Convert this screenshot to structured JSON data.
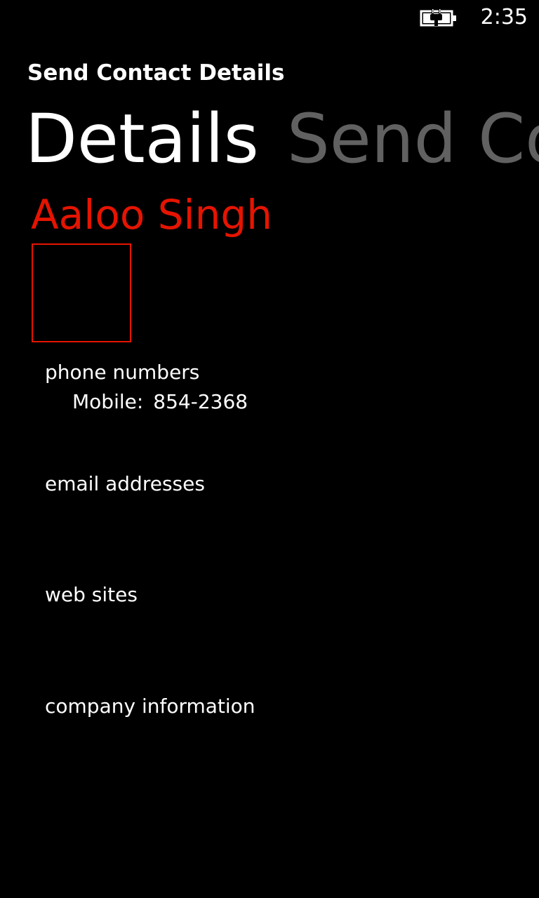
{
  "status_bar": {
    "time": "2:35",
    "battery_icon": "battery-charging-icon"
  },
  "app": {
    "title": "Send Contact Details"
  },
  "pivot": {
    "items": [
      {
        "label": "Details",
        "active": true
      },
      {
        "label": "Send Contact",
        "active": false
      }
    ]
  },
  "contact": {
    "name": "Aaloo Singh",
    "accent_color": "#e51400"
  },
  "sections": {
    "phone": {
      "header": "phone numbers",
      "entries": [
        {
          "label": "Mobile:",
          "value": "854-2368"
        }
      ]
    },
    "email": {
      "header": "email addresses"
    },
    "web": {
      "header": "web sites"
    },
    "company": {
      "header": "company information"
    }
  }
}
